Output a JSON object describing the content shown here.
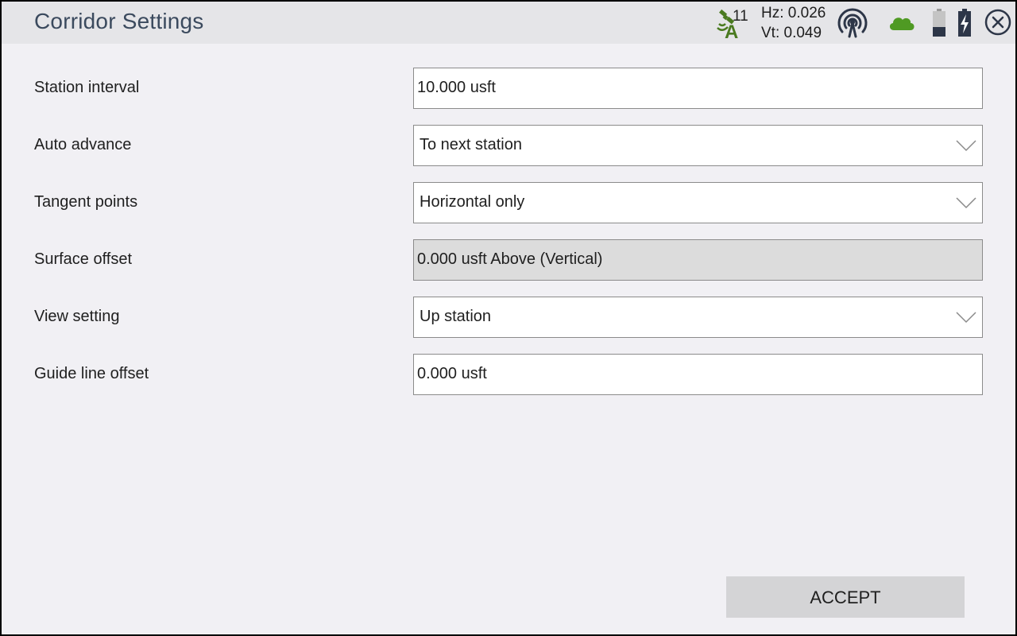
{
  "window": {
    "title": "Corridor Settings"
  },
  "status": {
    "satellites": "11",
    "hz": "Hz: 0.026",
    "vt": "Vt: 0.049",
    "icons": [
      "satellite-icon",
      "radio-icon",
      "cloud-icon",
      "battery-icon",
      "battery-charging-icon",
      "close-icon"
    ],
    "colors": {
      "satellite": "#4a7a20",
      "cloud": "#4f9a23",
      "icon_dark": "#2d3648"
    }
  },
  "form": {
    "station_interval": {
      "label": "Station interval",
      "value": "10.000 usft"
    },
    "auto_advance": {
      "label": "Auto advance",
      "value": "To next station"
    },
    "tangent_points": {
      "label": "Tangent points",
      "value": "Horizontal only"
    },
    "surface_offset": {
      "label": "Surface offset",
      "value": "0.000 usft Above (Vertical)"
    },
    "view_setting": {
      "label": "View setting",
      "value": "Up station"
    },
    "guide_line_offset": {
      "label": "Guide line offset",
      "value": "0.000 usft"
    }
  },
  "actions": {
    "accept": "ACCEPT"
  }
}
